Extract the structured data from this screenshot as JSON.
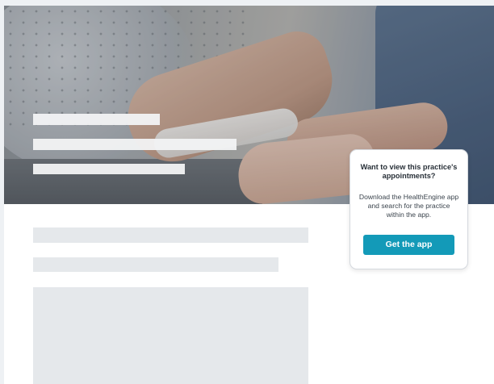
{
  "promo_card": {
    "title": "Want to view this practice's appointments?",
    "body": "Download the HealthEngine app and search for the practice within the app.",
    "button_label": "Get the app",
    "button_color": "#139ab8"
  },
  "colors": {
    "page_background": "#eef1f4",
    "skeleton_light": "#f2f3f4",
    "skeleton_gray": "#e5e8eb"
  }
}
